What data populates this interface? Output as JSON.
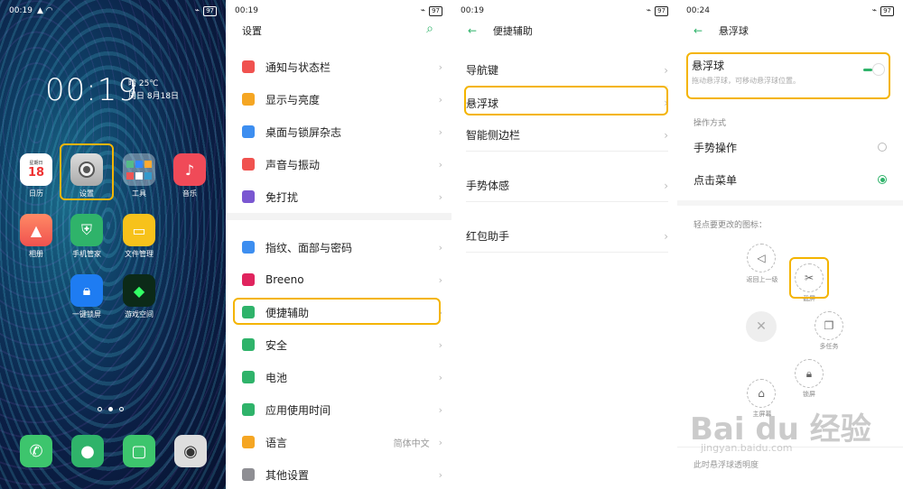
{
  "panel1": {
    "status": {
      "time": "00:19",
      "battery": "97"
    },
    "clock": "00:19",
    "weather_line1": "晴 25℃",
    "weather_line2": "周日 8月18日",
    "calendar_top": "星期日",
    "calendar_day": "18",
    "apps": [
      {
        "label": "日历",
        "icon": "calendar-icon"
      },
      {
        "label": "设置",
        "icon": "settings-gear-icon"
      },
      {
        "label": "工具",
        "icon": "tools-folder-icon"
      },
      {
        "label": "音乐",
        "icon": "music-icon"
      },
      {
        "label": "相册",
        "icon": "photos-icon"
      },
      {
        "label": "手机管家",
        "icon": "shield-icon"
      },
      {
        "label": "文件管理",
        "icon": "folder-icon"
      },
      {
        "label": "一键锁屏",
        "icon": "lock-icon"
      },
      {
        "label": "游戏空间",
        "icon": "game-cube-icon"
      }
    ],
    "dock": [
      {
        "icon": "phone-icon"
      },
      {
        "icon": "contacts-icon"
      },
      {
        "icon": "messages-icon"
      },
      {
        "icon": "camera-icon"
      }
    ]
  },
  "panel2": {
    "status": {
      "time": "00:19",
      "battery": "97"
    },
    "title": "设置",
    "items": [
      {
        "label": "通知与状态栏",
        "color": "#f0524f"
      },
      {
        "label": "显示与亮度",
        "color": "#f5a623"
      },
      {
        "label": "桌面与锁屏杂志",
        "color": "#3d8ef0"
      },
      {
        "label": "声音与振动",
        "color": "#f0524f"
      },
      {
        "label": "免打扰",
        "color": "#7a57d1"
      },
      {
        "label": "指纹、面部与密码",
        "color": "#3d8ef0"
      },
      {
        "label": "Breeno",
        "color": "#e0245e"
      },
      {
        "label": "便捷辅助",
        "color": "#2fb36a"
      },
      {
        "label": "安全",
        "color": "#2fb36a"
      },
      {
        "label": "电池",
        "color": "#2fb36a"
      },
      {
        "label": "应用使用时间",
        "color": "#2fb36a"
      },
      {
        "label": "语言",
        "value": "简体中文",
        "color": "#f5a623"
      },
      {
        "label": "其他设置",
        "color": "#8e8e93"
      }
    ]
  },
  "panel3": {
    "status": {
      "time": "00:19",
      "battery": "97"
    },
    "title": "便捷辅助",
    "items": [
      "导航键",
      "悬浮球",
      "智能侧边栏",
      "手势体感",
      "红包助手"
    ]
  },
  "panel4": {
    "status": {
      "time": "00:24",
      "battery": "97"
    },
    "title": "悬浮球",
    "toggle_title": "悬浮球",
    "toggle_desc": "拖动悬浮球，可移动悬浮球位置。",
    "section_label": "操作方式",
    "options": [
      "手势操作",
      "点击菜单"
    ],
    "icon_hint": "轻点要更改的图标：",
    "float_buttons": [
      {
        "label": "返回上一级",
        "icon": "back-triangle-icon"
      },
      {
        "label": "截屏",
        "icon": "screenshot-icon"
      },
      {
        "label": "多任务",
        "icon": "multitask-icon"
      },
      {
        "label": "锁屏",
        "icon": "lock-icon"
      },
      {
        "label": "主屏幕",
        "icon": "home-icon"
      }
    ],
    "footer_hint": "此时悬浮球透明度"
  },
  "watermark": {
    "text": "Bai du 经验",
    "url": "jingyan.baidu.com"
  }
}
